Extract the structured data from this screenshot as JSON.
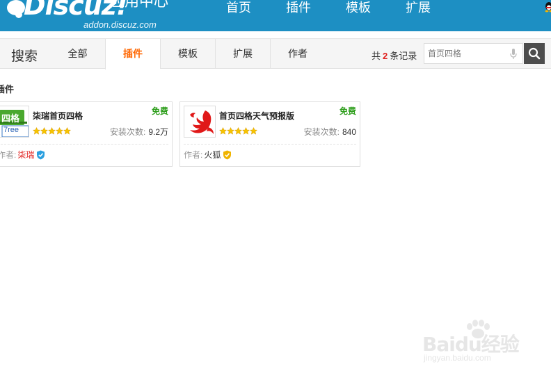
{
  "header": {
    "logo_word": "Discuz!",
    "logo_cn": "应用中心",
    "logo_url": "addon.discuz.com",
    "nav": [
      {
        "label": "首页"
      },
      {
        "label": "插件"
      },
      {
        "label": "模板"
      },
      {
        "label": "扩展"
      }
    ],
    "brand_color": "#1d8fc3"
  },
  "subbar": {
    "title": "搜索",
    "tabs": [
      {
        "label": "全部",
        "active": false
      },
      {
        "label": "插件",
        "active": true
      },
      {
        "label": "模板",
        "active": false
      },
      {
        "label": "扩展",
        "active": false
      },
      {
        "label": "作者",
        "active": false
      }
    ],
    "count_prefix": "共",
    "count": "2",
    "count_suffix": "条记录",
    "search_placeholder": "首页四格",
    "accent_color": "#ff6600"
  },
  "section": {
    "title": "插件"
  },
  "results": [
    {
      "name": "柒瑞首页四格",
      "price": "免费",
      "thumb_text_top": "四格",
      "thumb_text_bottom": "7ree",
      "rating": 5,
      "install_label": "安装次数:",
      "install_value": "9.2万",
      "author_label": "作者:",
      "author": "柒瑞",
      "author_color": "#e0201e",
      "badge_icon": "blue-shield-check-icon"
    },
    {
      "name": "首页四格天气预报版",
      "price": "免费",
      "thumb_text_top": "",
      "thumb_text_bottom": "",
      "rating": 5,
      "install_label": "安装次数:",
      "install_value": "840",
      "author_label": "作者:",
      "author": "火狐",
      "author_color": "#333333",
      "badge_icon": "gold-shield-check-icon"
    }
  ],
  "watermark": {
    "text": "Baidu经验",
    "url": "jingyan.baidu.com"
  }
}
